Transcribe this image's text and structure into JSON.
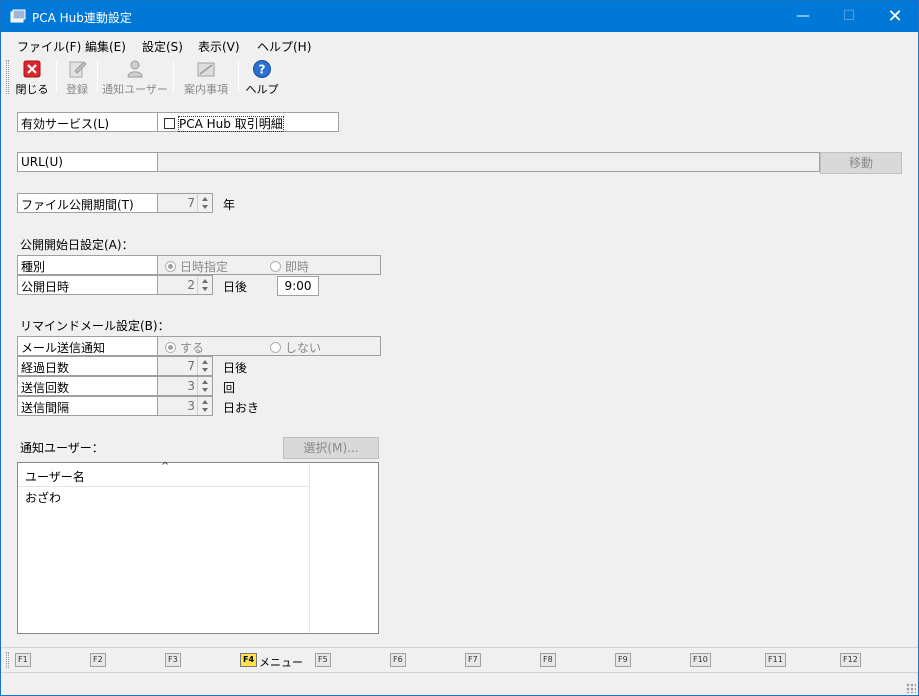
{
  "window": {
    "title": "PCA Hub連動設定",
    "min": "—",
    "max": "☐",
    "close": "✕"
  },
  "menu": [
    "ファイル(F)",
    "編集(E)",
    "設定(S)",
    "表示(V)",
    "ヘルプ(H)"
  ],
  "toolbar": {
    "close_label": "閉じる",
    "register_label": "登録",
    "notify_users_label": "通知ユーザー",
    "notice_label": "案内事項",
    "help_label": "ヘルプ"
  },
  "service": {
    "label": "有効サービス(L)",
    "checkbox_label": "PCA Hub 取引明細",
    "checked": false
  },
  "url": {
    "label": "URL(U)",
    "value": "",
    "go_button": "移動"
  },
  "file_period": {
    "label": "ファイル公開期間(T)",
    "value": "7",
    "unit": "年"
  },
  "publish_start": {
    "heading": "公開開始日設定(A)：",
    "kind_label": "種別",
    "option_specified": "日時指定",
    "option_immediate": "即時",
    "selected": "日時指定",
    "datetime_label": "公開日時",
    "days_value": "2",
    "days_unit": "日後",
    "time_value": "9:00"
  },
  "remind": {
    "heading": "リマインドメール設定(B)：",
    "send_label": "メール送信通知",
    "option_yes": "する",
    "option_no": "しない",
    "selected": "する",
    "elapsed_label": "経過日数",
    "elapsed_value": "7",
    "elapsed_unit": "日後",
    "count_label": "送信回数",
    "count_value": "3",
    "count_unit": "回",
    "interval_label": "送信間隔",
    "interval_value": "3",
    "interval_unit": "日おき"
  },
  "notify": {
    "heading": "通知ユーザー：",
    "select_button": "選択(M)...",
    "column_header": "ユーザー名",
    "sort_indicator": "^",
    "users": [
      "おざわ"
    ]
  },
  "fkeys": [
    {
      "key": "F1",
      "label": ""
    },
    {
      "key": "F2",
      "label": ""
    },
    {
      "key": "F3",
      "label": ""
    },
    {
      "key": "F4",
      "label": "メニュー"
    },
    {
      "key": "F5",
      "label": ""
    },
    {
      "key": "F6",
      "label": ""
    },
    {
      "key": "F7",
      "label": ""
    },
    {
      "key": "F8",
      "label": ""
    },
    {
      "key": "F9",
      "label": ""
    },
    {
      "key": "F10",
      "label": ""
    },
    {
      "key": "F11",
      "label": ""
    },
    {
      "key": "F12",
      "label": ""
    }
  ],
  "colors": {
    "titlebar": "#0078d7",
    "close_icon": "#d9262c",
    "help_icon": "#2a6fd1",
    "f4_active": "#ffe24a"
  }
}
